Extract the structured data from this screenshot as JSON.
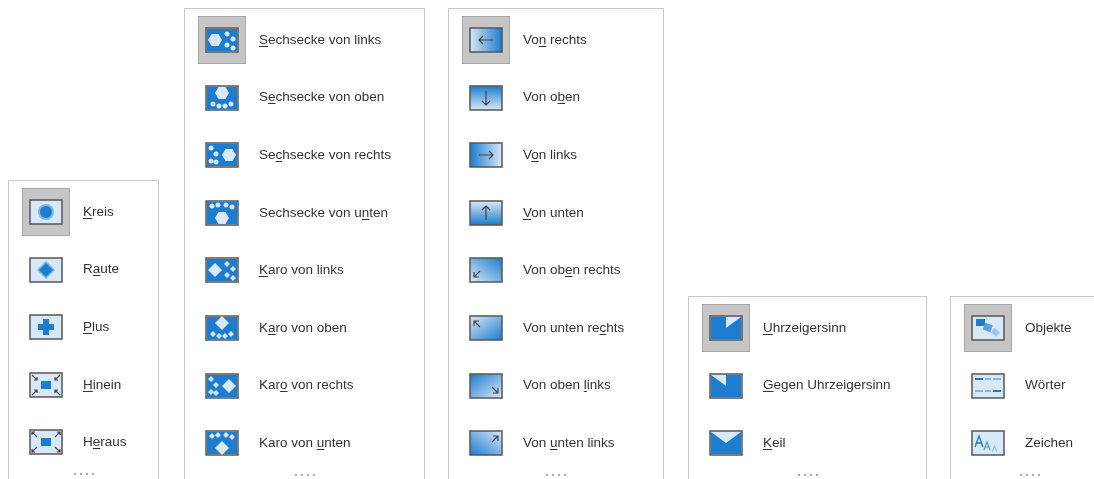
{
  "menus": [
    {
      "items": [
        {
          "access_key": "K",
          "label_end": "reis",
          "selected": true
        },
        {
          "label_start": "R",
          "access_key": "a",
          "label_end": "ute",
          "selected": false
        },
        {
          "access_key": "P",
          "label_end": "lus",
          "selected": false
        },
        {
          "access_key": "H",
          "label_end": "inein",
          "selected": false
        },
        {
          "label_start": "H",
          "access_key": "e",
          "label_end": "raus",
          "selected": false
        }
      ]
    },
    {
      "items": [
        {
          "access_key": "S",
          "label_end": "echsecke von links",
          "selected": true
        },
        {
          "label_start": "S",
          "access_key": "e",
          "label_end": "chsecke von oben",
          "selected": false
        },
        {
          "label_start": "Se",
          "access_key": "c",
          "label_end": "hsecke von rechts",
          "selected": false
        },
        {
          "label_start": "Sechsecke von u",
          "access_key": "n",
          "label_end": "ten",
          "selected": false
        },
        {
          "access_key": "K",
          "label_end": "aro von links",
          "selected": false
        },
        {
          "label_start": "K",
          "access_key": "a",
          "label_end": "ro von oben",
          "selected": false
        },
        {
          "label_start": "Kar",
          "access_key": "o",
          "label_end": " von rechts",
          "selected": false
        },
        {
          "label_start": "Karo von ",
          "access_key": "u",
          "label_end": "nten",
          "selected": false
        }
      ]
    },
    {
      "items": [
        {
          "label_start": "Vo",
          "access_key": "n",
          "label_end": " rechts",
          "selected": true
        },
        {
          "label_start": "Von o",
          "access_key": "b",
          "label_end": "en",
          "selected": false
        },
        {
          "label_start": "V",
          "access_key": "o",
          "label_end": "n links",
          "selected": false
        },
        {
          "access_key": "V",
          "label_end": "on unten",
          "selected": false
        },
        {
          "label_start": "Von ob",
          "access_key": "e",
          "label_end": "n rechts",
          "selected": false
        },
        {
          "label_start": "Von unten re",
          "access_key": "c",
          "label_end": "hts",
          "selected": false
        },
        {
          "label_start": "Von oben ",
          "access_key": "l",
          "label_end": "inks",
          "selected": false
        },
        {
          "label_start": "Von ",
          "access_key": "u",
          "label_end": "nten links",
          "selected": false
        }
      ]
    },
    {
      "items": [
        {
          "access_key": "U",
          "label_end": "hrzeigersinn",
          "selected": true
        },
        {
          "access_key": "G",
          "label_end": "egen Uhrzeigersinn",
          "selected": false
        },
        {
          "access_key": "K",
          "label_end": "eil",
          "selected": false
        }
      ]
    },
    {
      "items": [
        {
          "label": "Objekte",
          "selected": true
        },
        {
          "label": "Wörter",
          "selected": false
        },
        {
          "label": "Zeichen",
          "selected": false
        }
      ]
    }
  ]
}
